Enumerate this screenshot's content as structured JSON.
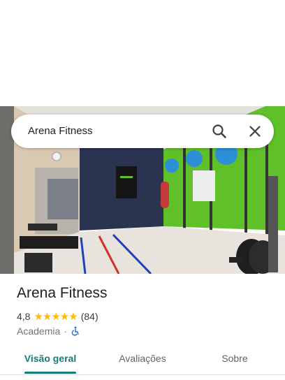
{
  "search": {
    "query": "Arena Fitness",
    "search_icon": "search-icon",
    "close_icon": "close-icon"
  },
  "place": {
    "name": "Arena Fitness",
    "rating": "4,8",
    "stars": "★★★★★",
    "review_count": "(84)",
    "category": "Academia",
    "separator": "·",
    "accessibility_icon": "wheelchair-accessible-icon"
  },
  "tabs": [
    {
      "label": "Visão geral",
      "active": true
    },
    {
      "label": "Avaliações",
      "active": false
    },
    {
      "label": "Sobre",
      "active": false
    }
  ],
  "colors": {
    "accent": "#137d79",
    "star": "#fbbc04",
    "wall_green": "#5fc02a",
    "wheelchair_blue": "#1a73e8"
  }
}
